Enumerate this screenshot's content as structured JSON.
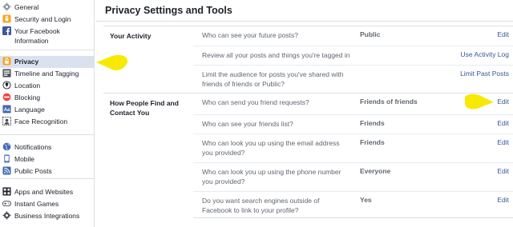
{
  "sidebar": {
    "groups": [
      [
        {
          "label": "General",
          "icon": "gear-icon"
        },
        {
          "label": "Security and Login",
          "icon": "shield-icon"
        },
        {
          "label": "Your Facebook Information",
          "icon": "facebook-icon"
        }
      ],
      [
        {
          "label": "Privacy",
          "icon": "lock-icon",
          "active": true
        },
        {
          "label": "Timeline and Tagging",
          "icon": "timeline-icon"
        },
        {
          "label": "Location",
          "icon": "location-icon"
        },
        {
          "label": "Blocking",
          "icon": "block-icon"
        },
        {
          "label": "Language",
          "icon": "language-icon"
        },
        {
          "label": "Face Recognition",
          "icon": "face-recognition-icon"
        }
      ],
      [
        {
          "label": "Notifications",
          "icon": "globe-icon"
        },
        {
          "label": "Mobile",
          "icon": "mobile-icon"
        },
        {
          "label": "Public Posts",
          "icon": "rss-icon"
        }
      ],
      [
        {
          "label": "Apps and Websites",
          "icon": "apps-icon"
        },
        {
          "label": "Instant Games",
          "icon": "gamepad-icon"
        },
        {
          "label": "Business Integrations",
          "icon": "business-icon"
        }
      ]
    ]
  },
  "main": {
    "title": "Privacy Settings and Tools",
    "sections": [
      {
        "heading": "Your Activity",
        "rows": [
          {
            "question": "Who can see your future posts?",
            "value": "Public",
            "action": "Edit"
          },
          {
            "question": "Review all your posts and things you're tagged in",
            "value": "",
            "action": "Use Activity Log"
          },
          {
            "question": "Limit the audience for posts you've shared with friends of friends or Public?",
            "value": "",
            "action": "Limit Past Posts"
          }
        ]
      },
      {
        "heading": "How People Find and Contact You",
        "rows": [
          {
            "question": "Who can send you friend requests?",
            "value": "Friends of friends",
            "action": "Edit"
          },
          {
            "question": "Who can see your friends list?",
            "value": "Friends",
            "action": "Edit"
          },
          {
            "question": "Who can look you up using the email address you provided?",
            "value": "Friends",
            "action": "Edit"
          },
          {
            "question": "Who can look you up using the phone number you provided?",
            "value": "Everyone",
            "action": "Edit"
          },
          {
            "question": "Do you want search engines outside of Facebook to link to your profile?",
            "value": "Yes",
            "action": "Edit"
          }
        ]
      }
    ]
  },
  "colors": {
    "link": "#385898",
    "active_bg": "#dbe2ef",
    "highlight_marker": "#f7ea00",
    "border": "#dddfe2"
  }
}
